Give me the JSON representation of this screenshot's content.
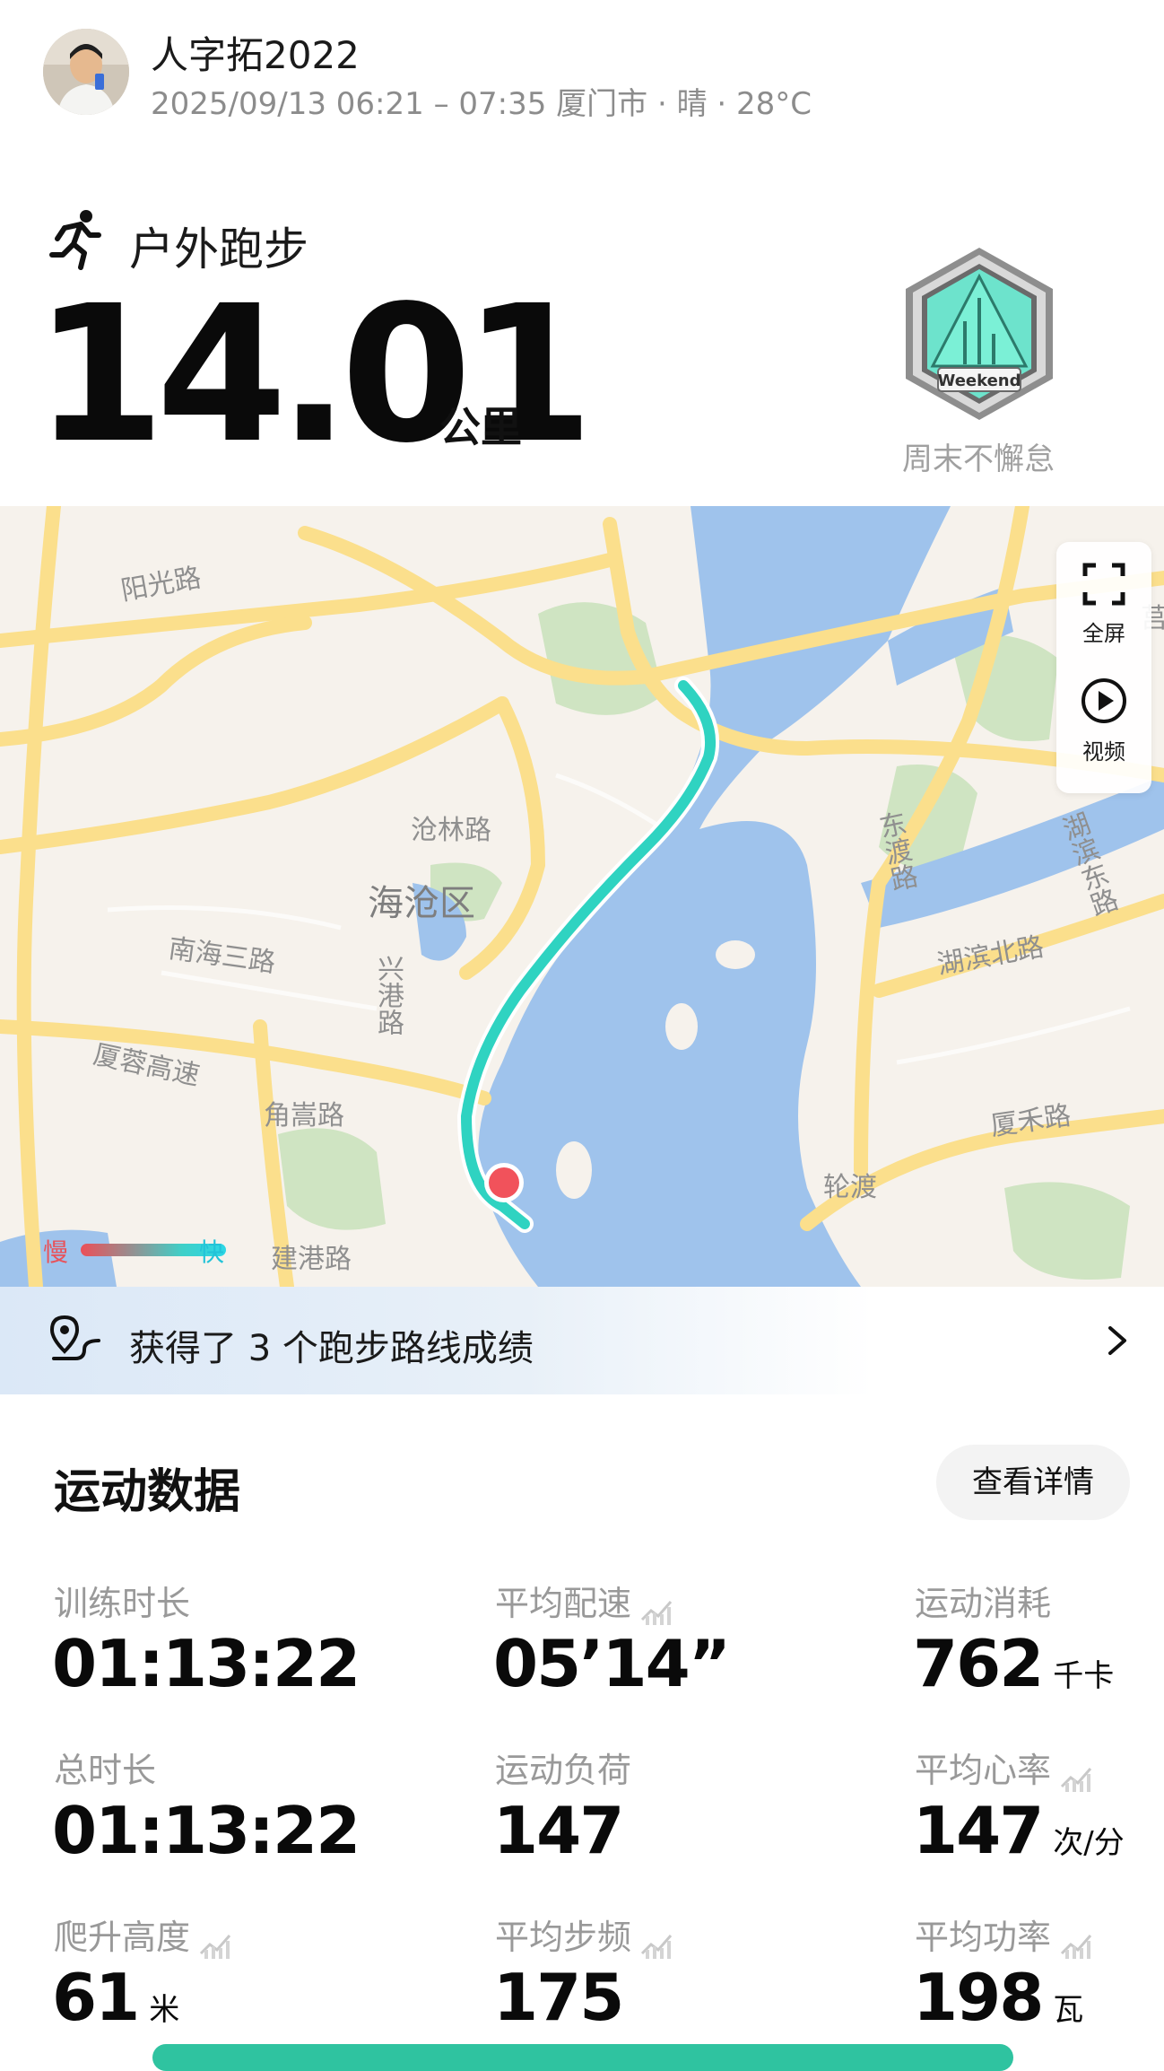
{
  "header": {
    "username": "人字拓2022",
    "subtitle": "2025/09/13 06:21 – 07:35 厦门市 · 晴 · 28°C"
  },
  "activity": {
    "type": "户外跑步",
    "distance": "14.01",
    "distance_unit": "公里",
    "badge_text": "Weekend",
    "badge_caption": "周末不懈怠"
  },
  "map": {
    "labels": {
      "yangguang_road": "阳光路",
      "canglin_road": "沧林路",
      "haicang_district": "海沧区",
      "nanhai3_road": "南海三路",
      "xinggang_road": "兴港路",
      "xiarong_highway": "厦蓉高速",
      "jiaosong_road": "角嵩路",
      "jiangang_road": "建港路",
      "dongdu_road": "东渡路",
      "hubin_north_road": "湖滨北路",
      "hubin_east_road": "湖滨东路",
      "xiahe_road": "厦禾路",
      "ferry": "轮渡",
      "edge_char": "莒"
    },
    "controls": {
      "fullscreen": "全屏",
      "video": "视频"
    },
    "speed_legend": {
      "slow": "慢",
      "fast": "快",
      "slow_color": "#ec4f58",
      "fast_color": "#2cd7e6"
    }
  },
  "achievement": {
    "text": "获得了 3 个跑步路线成绩"
  },
  "stats": {
    "title": "运动数据",
    "details_button": "查看详情",
    "items": [
      {
        "label": "训练时长",
        "value": "01:13:22",
        "unit": ""
      },
      {
        "label": "平均配速",
        "value": "05’14”",
        "unit": ""
      },
      {
        "label": "运动消耗",
        "value": "762",
        "unit": "千卡"
      },
      {
        "label": "总时长",
        "value": "01:13:22",
        "unit": ""
      },
      {
        "label": "运动负荷",
        "value": "147",
        "unit": ""
      },
      {
        "label": "平均心率",
        "value": "147",
        "unit": "次/分"
      },
      {
        "label": "爬升高度",
        "value": "61",
        "unit": "米"
      },
      {
        "label": "平均步频",
        "value": "175",
        "unit": ""
      },
      {
        "label": "平均功率",
        "value": "198",
        "unit": "瓦"
      }
    ]
  },
  "colors": {
    "route_start": "#f1525b",
    "route": "#2fd3c1",
    "water": "#9fc3ec",
    "road": "#fbdf8c",
    "park": "#cfe4c2"
  }
}
